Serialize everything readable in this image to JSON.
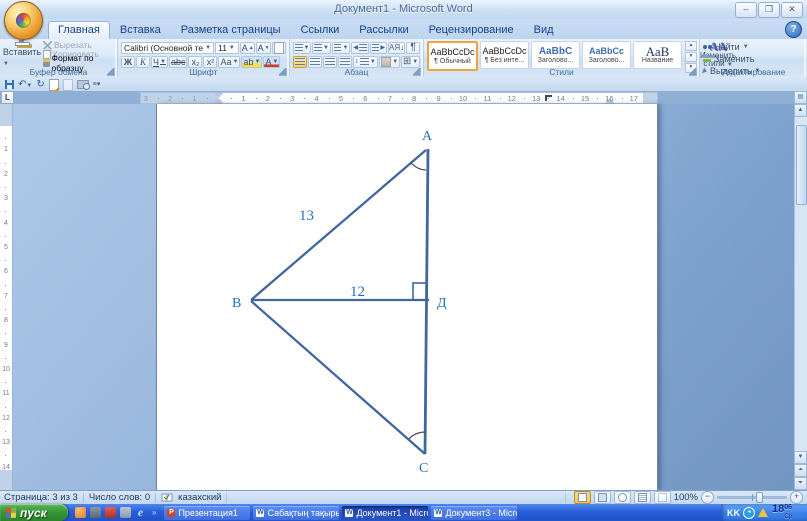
{
  "window": {
    "title": "Документ1 - Microsoft Word"
  },
  "ribbon": {
    "tabs": [
      {
        "label": "Главная",
        "active": true
      },
      {
        "label": "Вставка",
        "active": false
      },
      {
        "label": "Разметка страницы",
        "active": false
      },
      {
        "label": "Ссылки",
        "active": false
      },
      {
        "label": "Рассылки",
        "active": false
      },
      {
        "label": "Рецензирование",
        "active": false
      },
      {
        "label": "Вид",
        "active": false
      }
    ],
    "clipboard": {
      "label": "Буфер обмена",
      "paste": "Вставить",
      "cut": "Вырезать",
      "copy": "Копировать",
      "format_painter": "Формат по образцу"
    },
    "font": {
      "label": "Шрифт",
      "name": "Calibri (Основной те",
      "size": "11",
      "grow": "А",
      "shrink": "A",
      "bold": "Ж",
      "italic": "К",
      "underline": "Ч",
      "strike": "abc",
      "subscript": "x₂",
      "superscript": "x²",
      "change_case": "Aa",
      "highlight": "ab",
      "color": "А"
    },
    "paragraph": {
      "label": "Абзац",
      "sort": "АЯ↓",
      "pilcrow": "¶",
      "borders": "⊞"
    },
    "styles": {
      "label": "Стили",
      "change_line1": "Изменить",
      "change_line2": "стили",
      "items": [
        {
          "preview": "AaBbCcDc",
          "name": "¶ Обычный",
          "kind": "plain",
          "selected": true
        },
        {
          "preview": "AaBbCcDc",
          "name": "¶ Без инте...",
          "kind": "plain",
          "selected": false
        },
        {
          "preview": "AaBbC",
          "name": "Заголово...",
          "kind": "h1",
          "selected": false
        },
        {
          "preview": "AaBbCc",
          "name": "Заголово...",
          "kind": "h2",
          "selected": false
        },
        {
          "preview": "АаВ",
          "name": "Название",
          "kind": "title",
          "selected": false
        }
      ]
    },
    "editing": {
      "label": "Редактирование",
      "find": "Найти",
      "replace": "Заменить",
      "select": "Выделить"
    }
  },
  "ruler": {
    "left_numbers": [
      "3",
      "2",
      "1"
    ],
    "numbers": [
      "1",
      "2",
      "3",
      "4",
      "5",
      "6",
      "7",
      "8",
      "9",
      "10",
      "11",
      "12",
      "13",
      "14",
      "15",
      "16",
      "17"
    ],
    "v_numbers": [
      "1",
      "2",
      "3",
      "4",
      "5",
      "6",
      "7",
      "8",
      "9",
      "10",
      "11",
      "12",
      "13",
      "14"
    ]
  },
  "figure": {
    "vertex_top": "A",
    "vertex_left": "В",
    "vertex_bottom": "С",
    "foot": "Д",
    "side_ab": "13",
    "segment_bd": "12"
  },
  "status": {
    "page": "Страница: 3 из 3",
    "words": "Число слов: 0",
    "language": "казахский",
    "zoom": "100%"
  },
  "taskbar": {
    "start": "пуск",
    "overflow": "»",
    "buttons": [
      {
        "label": "Презентация1",
        "app": "ppt",
        "active": false
      },
      {
        "label": "Сабақтың тақырыб...",
        "app": "word",
        "active": false
      },
      {
        "label": "Документ1 - Microso...",
        "app": "word",
        "active": true
      },
      {
        "label": "Документ3 - Microso...",
        "app": "word",
        "active": false
      }
    ],
    "tray": {
      "lang": "KK",
      "hour": "18",
      "minute": "06",
      "day": "Ср"
    }
  }
}
